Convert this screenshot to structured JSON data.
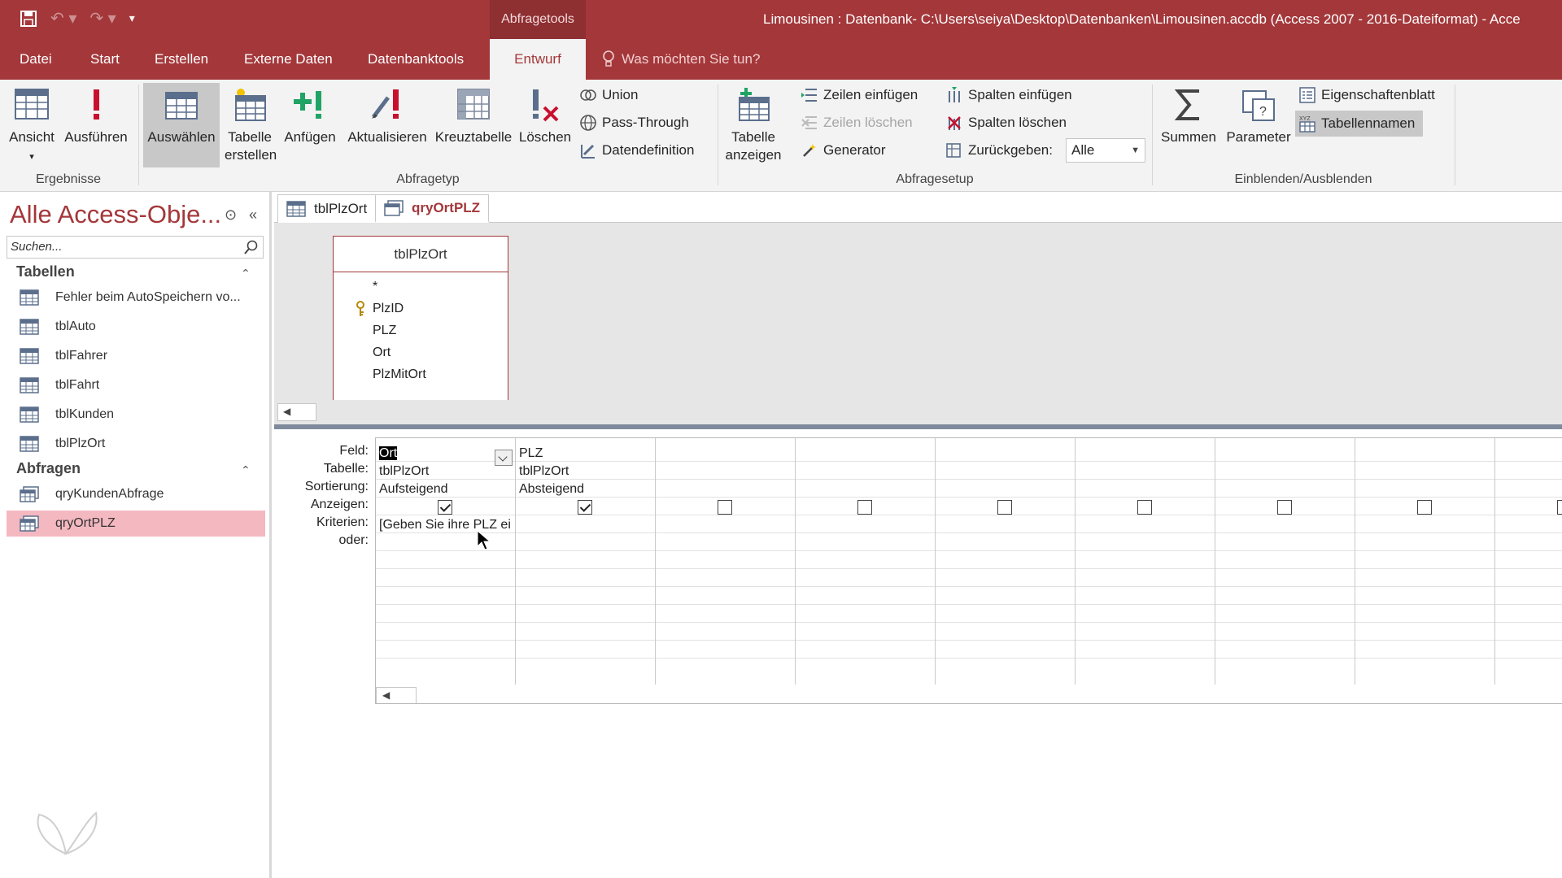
{
  "titlebar": {
    "context_tools": "Abfragetools",
    "window_title": "Limousinen : Datenbank- C:\\Users\\seiya\\Desktop\\Datenbanken\\Limousinen.accdb (Access 2007 - 2016-Dateiformat) - Acce"
  },
  "tabs": {
    "datei": "Datei",
    "start": "Start",
    "erstellen": "Erstellen",
    "externe": "Externe Daten",
    "datenbanktools": "Datenbanktools",
    "entwurf": "Entwurf",
    "tellme": "Was möchten Sie tun?"
  },
  "ribbon": {
    "ansicht": "Ansicht",
    "ausfuehren": "Ausführen",
    "ergebnisse": "Ergebnisse",
    "auswaehlen": "Auswählen",
    "tabelle_erstellen_1": "Tabelle",
    "tabelle_erstellen_2": "erstellen",
    "anfuegen": "Anfügen",
    "aktualisieren": "Aktualisieren",
    "kreuztabelle": "Kreuztabelle",
    "loeschen": "Löschen",
    "union": "Union",
    "pass_through": "Pass-Through",
    "datendefinition": "Datendefinition",
    "abfragetyp": "Abfragetyp",
    "tabelle_anzeigen_1": "Tabelle",
    "tabelle_anzeigen_2": "anzeigen",
    "zeilen_einfuegen": "Zeilen einfügen",
    "zeilen_loeschen": "Zeilen löschen",
    "generator": "Generator",
    "spalten_einfuegen": "Spalten einfügen",
    "spalten_loeschen": "Spalten löschen",
    "zurueckgeben": "Zurückgeben:",
    "zurueckgeben_value": "Alle",
    "abfragesetup": "Abfragesetup",
    "summen": "Summen",
    "parameter": "Parameter",
    "eigenschaftenblatt": "Eigenschaftenblatt",
    "tabellennamen": "Tabellennamen",
    "einblenden": "Einblenden/Ausblenden"
  },
  "nav": {
    "title": "Alle Access-Obje...",
    "search_placeholder": "Suchen...",
    "section_tables": "Tabellen",
    "section_queries": "Abfragen",
    "tables": [
      "Fehler beim AutoSpeichern vo...",
      "tblAuto",
      "tblFahrer",
      "tblFahrt",
      "tblKunden",
      "tblPlzOrt"
    ],
    "queries": [
      "qryKundenAbfrage",
      "qryOrtPLZ"
    ]
  },
  "doc": {
    "tab1": "tblPlzOrt",
    "tab2": "qryOrtPLZ"
  },
  "fieldlist": {
    "title": "tblPlzOrt",
    "fields": [
      "*",
      "PlzID",
      "PLZ",
      "Ort",
      "PlzMitOrt"
    ]
  },
  "grid": {
    "labels": {
      "feld": "Feld:",
      "tabelle": "Tabelle:",
      "sortierung": "Sortierung:",
      "anzeigen": "Anzeigen:",
      "kriterien": "Kriterien:",
      "oder": "oder:"
    },
    "col1": {
      "feld": "Ort",
      "tabelle": "tblPlzOrt",
      "sortierung": "Aufsteigend",
      "kriterien": "[Geben Sie ihre PLZ ei"
    },
    "col2": {
      "feld": "PLZ",
      "tabelle": "tblPlzOrt",
      "sortierung": "Absteigend"
    }
  },
  "colors": {
    "accent": "#a4373a",
    "selected_nav": "#f4b8c1"
  }
}
